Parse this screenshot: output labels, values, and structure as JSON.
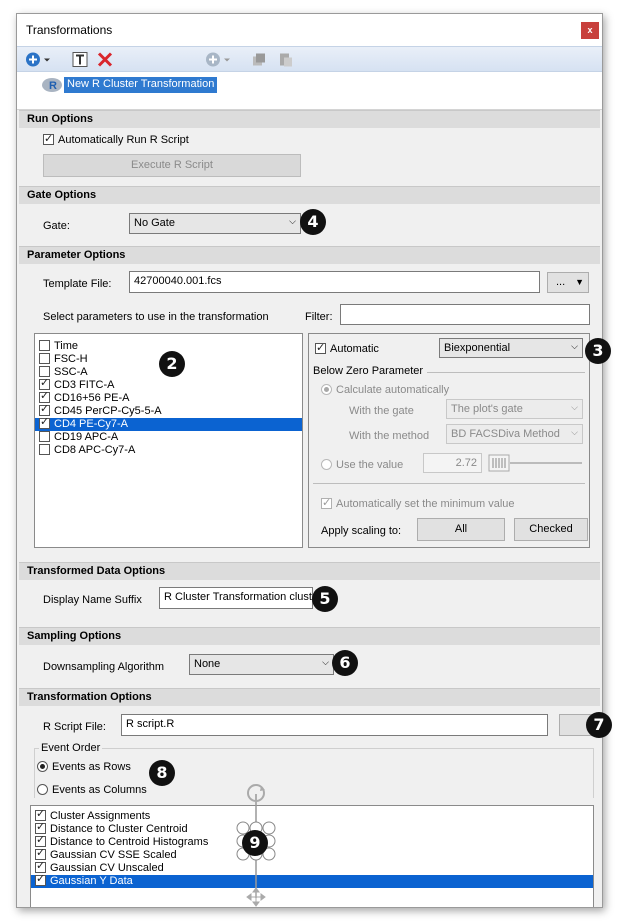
{
  "window": {
    "title": "Transformations",
    "close_glyph": "x"
  },
  "toolbar": {
    "icons": [
      "add-icon",
      "dropdown-arrow-icon",
      "text-icon",
      "delete-icon",
      "add-disabled-icon",
      "dropdown-arrow-icon",
      "copy-icon",
      "paste-icon"
    ]
  },
  "tree": {
    "selected_label": "New R Cluster Transformation",
    "icon": "r-icon"
  },
  "run_options": {
    "header": "Run Options",
    "auto_run_label": "Automatically Run R Script",
    "auto_run_checked": true,
    "execute_label": "Execute R Script"
  },
  "gate_options": {
    "header": "Gate Options",
    "gate_label": "Gate:",
    "gate_value": "No Gate"
  },
  "parameter_options": {
    "header": "Parameter Options",
    "template_label": "Template File:",
    "template_value": "42700040.001.fcs",
    "browse_label": "...",
    "select_label": "Select parameters to use in the transformation",
    "filter_label": "Filter:",
    "filter_value": "",
    "params": [
      {
        "label": "Time",
        "checked": false,
        "selected": false
      },
      {
        "label": "FSC-H",
        "checked": false,
        "selected": false
      },
      {
        "label": "SSC-A",
        "checked": false,
        "selected": false
      },
      {
        "label": "CD3 FITC-A",
        "checked": true,
        "selected": false
      },
      {
        "label": "CD16+56 PE-A",
        "checked": true,
        "selected": false
      },
      {
        "label": "CD45 PerCP-Cy5-5-A",
        "checked": true,
        "selected": false
      },
      {
        "label": "CD4 PE-Cy7-A",
        "checked": true,
        "selected": true
      },
      {
        "label": "CD19 APC-A",
        "checked": false,
        "selected": false
      },
      {
        "label": "CD8 APC-Cy7-A",
        "checked": false,
        "selected": false
      }
    ],
    "automatic_label": "Automatic",
    "scale_value": "Biexponential",
    "below_zero_label": "Below Zero Parameter",
    "calc_auto_label": "Calculate automatically",
    "with_gate_label": "With the gate",
    "with_gate_value": "The plot's gate",
    "with_method_label": "With the method",
    "with_method_value": "BD FACSDiva Method",
    "use_value_label": "Use the value",
    "use_value_value": "2.72",
    "auto_min_label": "Automatically set the minimum value",
    "apply_scaling_label": "Apply scaling to:",
    "all_label": "All",
    "checked_label": "Checked"
  },
  "transformed_data_options": {
    "header": "Transformed Data Options",
    "suffix_label": "Display Name Suffix",
    "suffix_value": "R Cluster Transformation clust"
  },
  "sampling_options": {
    "header": "Sampling Options",
    "algo_label": "Downsampling Algorithm",
    "algo_value": "None"
  },
  "transformation_options": {
    "header": "Transformation Options",
    "script_label": "R Script File:",
    "script_value": "R script.R",
    "event_order_label": "Event Order",
    "rows_label": "Events as Rows",
    "columns_label": "Events as Columns",
    "outputs": [
      {
        "label": "Cluster Assignments",
        "checked": true,
        "selected": false
      },
      {
        "label": "Distance to Cluster Centroid",
        "checked": true,
        "selected": false
      },
      {
        "label": "Distance to Centroid Histograms",
        "checked": true,
        "selected": false
      },
      {
        "label": "Gaussian CV SSE Scaled",
        "checked": true,
        "selected": false
      },
      {
        "label": "Gaussian CV Unscaled",
        "checked": true,
        "selected": false
      },
      {
        "label": "Gaussian Y Data",
        "checked": true,
        "selected": true
      }
    ]
  },
  "callouts": [
    "2",
    "3",
    "4",
    "5",
    "6",
    "7",
    "8",
    "9"
  ],
  "colors": {
    "selection": "#0b63d1",
    "section_header": "#dcdcdc",
    "close_button": "#c8403c",
    "toolbar": "#d6e2f2"
  }
}
